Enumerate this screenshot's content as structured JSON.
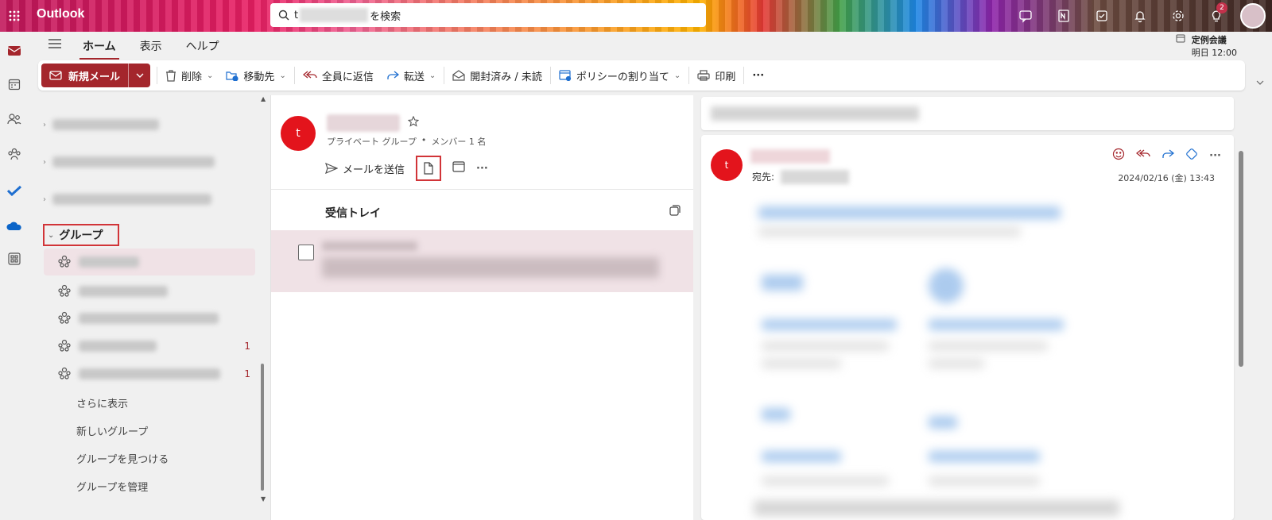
{
  "app": {
    "name": "Outlook",
    "search_text": "t",
    "search_suffix": "を検索",
    "notification_count": "2"
  },
  "ribbon": {
    "tabs": [
      {
        "label": "ホーム"
      },
      {
        "label": "表示"
      },
      {
        "label": "ヘルプ"
      }
    ],
    "meeting_title": "定例会議",
    "meeting_time": "明日 12:00"
  },
  "toolbar": {
    "new_mail": "新規メール",
    "delete": "削除",
    "move_to": "移動先",
    "reply_all": "全員に返信",
    "forward": "転送",
    "read_unread": "開封済み / 未読",
    "policy": "ポリシーの割り当て",
    "print": "印刷",
    "more": "···"
  },
  "folders": {
    "group_header": "グループ",
    "group_counts": [
      "1",
      "1"
    ],
    "links": [
      "さらに表示",
      "新しいグループ",
      "グループを見つける",
      "グループを管理"
    ]
  },
  "group_card": {
    "avatar_letter": "t",
    "type": "プライベート グループ",
    "members": "メンバー 1 名",
    "send_mail": "メールを送信",
    "more": "···"
  },
  "inbox": {
    "title": "受信トレイ"
  },
  "reading": {
    "avatar_letter": "t",
    "to_label": "宛先:",
    "date": "2024/02/16 (金) 13:43",
    "more": "···"
  },
  "colors": {
    "accent": "#a4262c",
    "avatar": "#e3141c",
    "selected": "#f0e2e6",
    "highlight": "#d13438"
  }
}
